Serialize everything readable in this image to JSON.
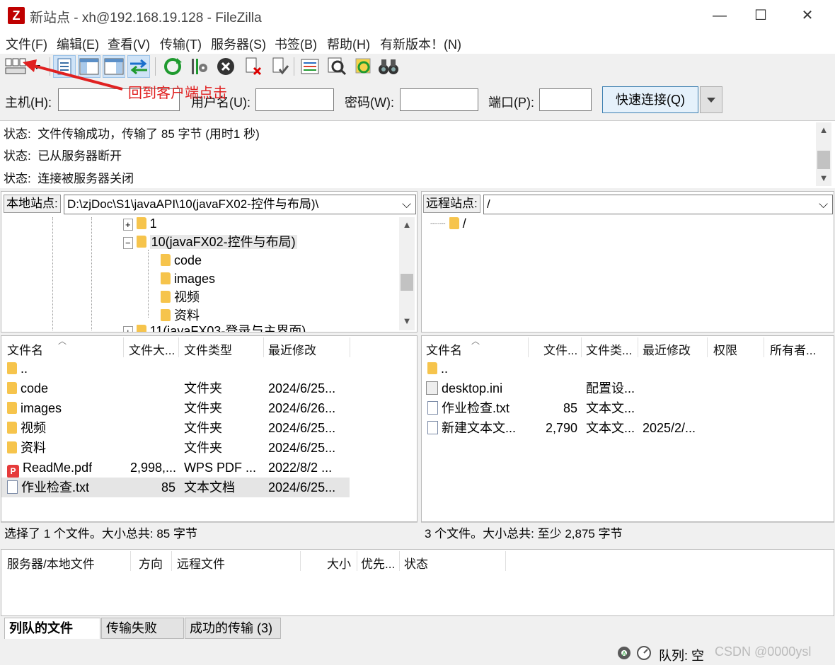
{
  "window": {
    "title": "新站点 - xh@192.168.19.128 - FileZilla",
    "icon_letter": "Z",
    "minimize": "—",
    "maximize": "☐",
    "close": "✕"
  },
  "menu": [
    "文件(F)",
    "编辑(E)",
    "查看(V)",
    "传输(T)",
    "服务器(S)",
    "书签(B)",
    "帮助(H)",
    "有新版本！(N)"
  ],
  "toolbar": [
    "site-manager-icon",
    "toggle-message-log-icon",
    "toggle-local-tree-icon",
    "toggle-remote-tree-icon",
    "toggle-transfer-queue-icon",
    "refresh-icon",
    "process-queue-icon",
    "cancel-icon",
    "disconnect-icon",
    "reconnect-icon",
    "directory-listing-filter-icon",
    "directory-comparison-icon",
    "synchronized-browsing-icon",
    "search-remote-files-icon"
  ],
  "annotation": {
    "text": "回到客户端点击",
    "color": "#e02020"
  },
  "quickconnect": {
    "host_label": "主机(H):",
    "host_value": "",
    "user_label": "用户名(U):",
    "user_value": "",
    "password_label": "密码(W):",
    "password_value": "",
    "port_label": "端口(P):",
    "port_value": "",
    "button": "快速连接(Q)"
  },
  "log": [
    {
      "label": "状态:",
      "text": "文件传输成功，传输了 85 字节 (用时1 秒)"
    },
    {
      "label": "状态:",
      "text": "已从服务器断开"
    },
    {
      "label": "状态:",
      "text": "连接被服务器关闭"
    }
  ],
  "local": {
    "site_label": "本地站点:",
    "path": "D:\\zjDoc\\S1\\javaAPI\\10(javaFX02-控件与布局)\\",
    "tree": [
      {
        "name": "1",
        "expander": "+"
      },
      {
        "name": "10(javaFX02-控件与布局)",
        "expander": "−",
        "selected": true
      },
      {
        "name": "code"
      },
      {
        "name": "images"
      },
      {
        "name": "视频"
      },
      {
        "name": "资料"
      },
      {
        "name": "11(javaFX03-登录与主界面)",
        "expander": "+"
      }
    ],
    "columns": [
      "文件名",
      "文件大...",
      "文件类型",
      "最近修改"
    ],
    "files": [
      {
        "name": "..",
        "size": "",
        "type": "",
        "modified": "",
        "icon": "folder"
      },
      {
        "name": "code",
        "size": "",
        "type": "文件夹",
        "modified": "2024/6/25...",
        "icon": "folder"
      },
      {
        "name": "images",
        "size": "",
        "type": "文件夹",
        "modified": "2024/6/26...",
        "icon": "folder"
      },
      {
        "name": "视频",
        "size": "",
        "type": "文件夹",
        "modified": "2024/6/25...",
        "icon": "folder"
      },
      {
        "name": "资料",
        "size": "",
        "type": "文件夹",
        "modified": "2024/6/25...",
        "icon": "folder"
      },
      {
        "name": "ReadMe.pdf",
        "size": "2,998,...",
        "type": "WPS PDF ...",
        "modified": "2022/8/2 ...",
        "icon": "pdf"
      },
      {
        "name": "作业检查.txt",
        "size": "85",
        "type": "文本文档",
        "modified": "2024/6/25...",
        "icon": "txt",
        "selected": true
      }
    ],
    "status": "选择了 1 个文件。大小总共: 85 字节"
  },
  "remote": {
    "site_label": "远程站点:",
    "path": "/",
    "tree": [
      {
        "name": "/"
      }
    ],
    "columns": [
      "文件名",
      "文件...",
      "文件类...",
      "最近修改",
      "权限",
      "所有者..."
    ],
    "files": [
      {
        "name": "..",
        "size": "",
        "type": "",
        "modified": "",
        "icon": "folder"
      },
      {
        "name": "desktop.ini",
        "size": "",
        "type": "配置设...",
        "modified": "",
        "icon": "ini"
      },
      {
        "name": "作业检查.txt",
        "size": "85",
        "type": "文本文...",
        "modified": "",
        "icon": "txt"
      },
      {
        "name": "新建文本文...",
        "size": "2,790",
        "type": "文本文...",
        "modified": "2025/2/...",
        "icon": "txt"
      }
    ],
    "status": "3 个文件。大小总共: 至少 2,875 字节"
  },
  "queue": {
    "columns": [
      "服务器/本地文件",
      "方向",
      "远程文件",
      "大小",
      "优先...",
      "状态"
    ],
    "tabs": [
      "列队的文件",
      "传输失败",
      "成功的传输 (3)"
    ]
  },
  "statusbar": {
    "queue_text": "队列: 空",
    "watermark": "CSDN @0000ysl"
  }
}
